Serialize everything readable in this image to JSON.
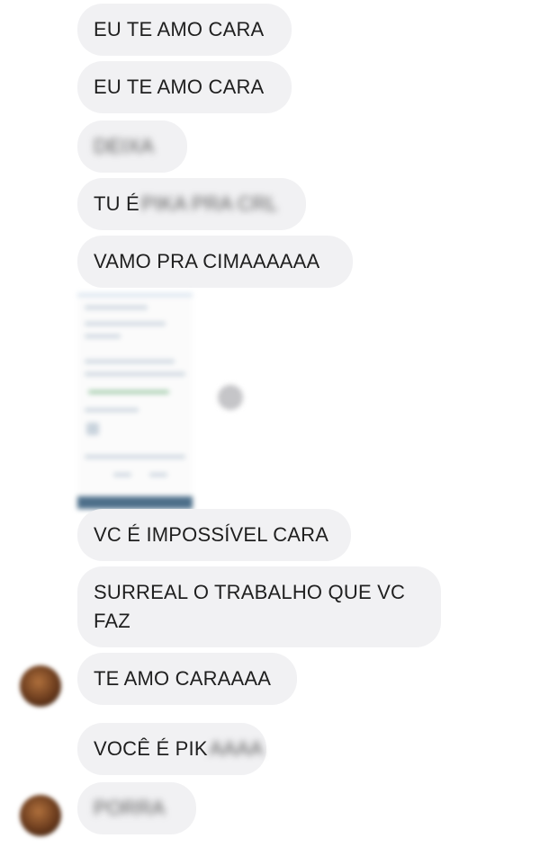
{
  "messages": [
    {
      "text": "EU TE AMO CARA"
    },
    {
      "text": "EU TE AMO CARA"
    },
    {
      "text": "DEIXA"
    },
    {
      "visible": "TU É",
      "hidden": "PIKA PRA CRL"
    },
    {
      "text": "VAMO PRA CIMAAAAAA"
    },
    {
      "text": "VC É IMPOSSÍVEL CARA"
    },
    {
      "text": "SURREAL O TRABALHO QUE VC FAZ"
    },
    {
      "text": "TE AMO CARAAAA"
    },
    {
      "visible": "VOCÊ É PIK",
      "hidden": "AAAA"
    },
    {
      "text": "PORRA"
    }
  ],
  "icons": {
    "share": "share-icon",
    "avatar": "avatar"
  },
  "colors": {
    "bubble_bg": "#f1f1f3",
    "text": "#1f1f1f"
  }
}
